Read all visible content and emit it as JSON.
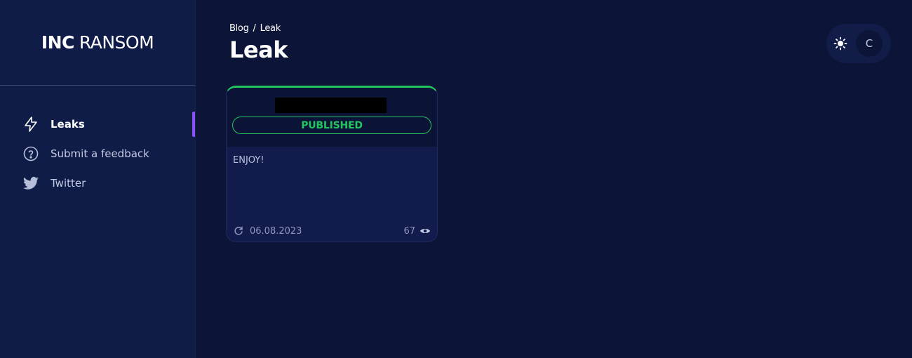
{
  "sidebar": {
    "logo": {
      "bold": "INC",
      "light": "RANSOM"
    },
    "items": [
      {
        "label": "Leaks",
        "icon": "lightning-icon",
        "active": true
      },
      {
        "label": "Submit a feedback",
        "icon": "question-circle-icon",
        "active": false
      },
      {
        "label": "Twitter",
        "icon": "twitter-icon",
        "active": false
      }
    ]
  },
  "header": {
    "breadcrumb": {
      "parent": "Blog",
      "separator": "/",
      "current": "Leak"
    },
    "title": "Leak",
    "theme_icon": "sun-icon",
    "avatar_letter": "C"
  },
  "card": {
    "status": "PUBLISHED",
    "description": "ENJOY!",
    "date": "06.08.2023",
    "views": "67",
    "date_icon": "refresh-icon",
    "views_icon": "eye-icon"
  },
  "colors": {
    "background": "#0c1538",
    "sidebar": "#101c48",
    "accent_active": "#8a52f5",
    "status_green": "#22c55e"
  }
}
